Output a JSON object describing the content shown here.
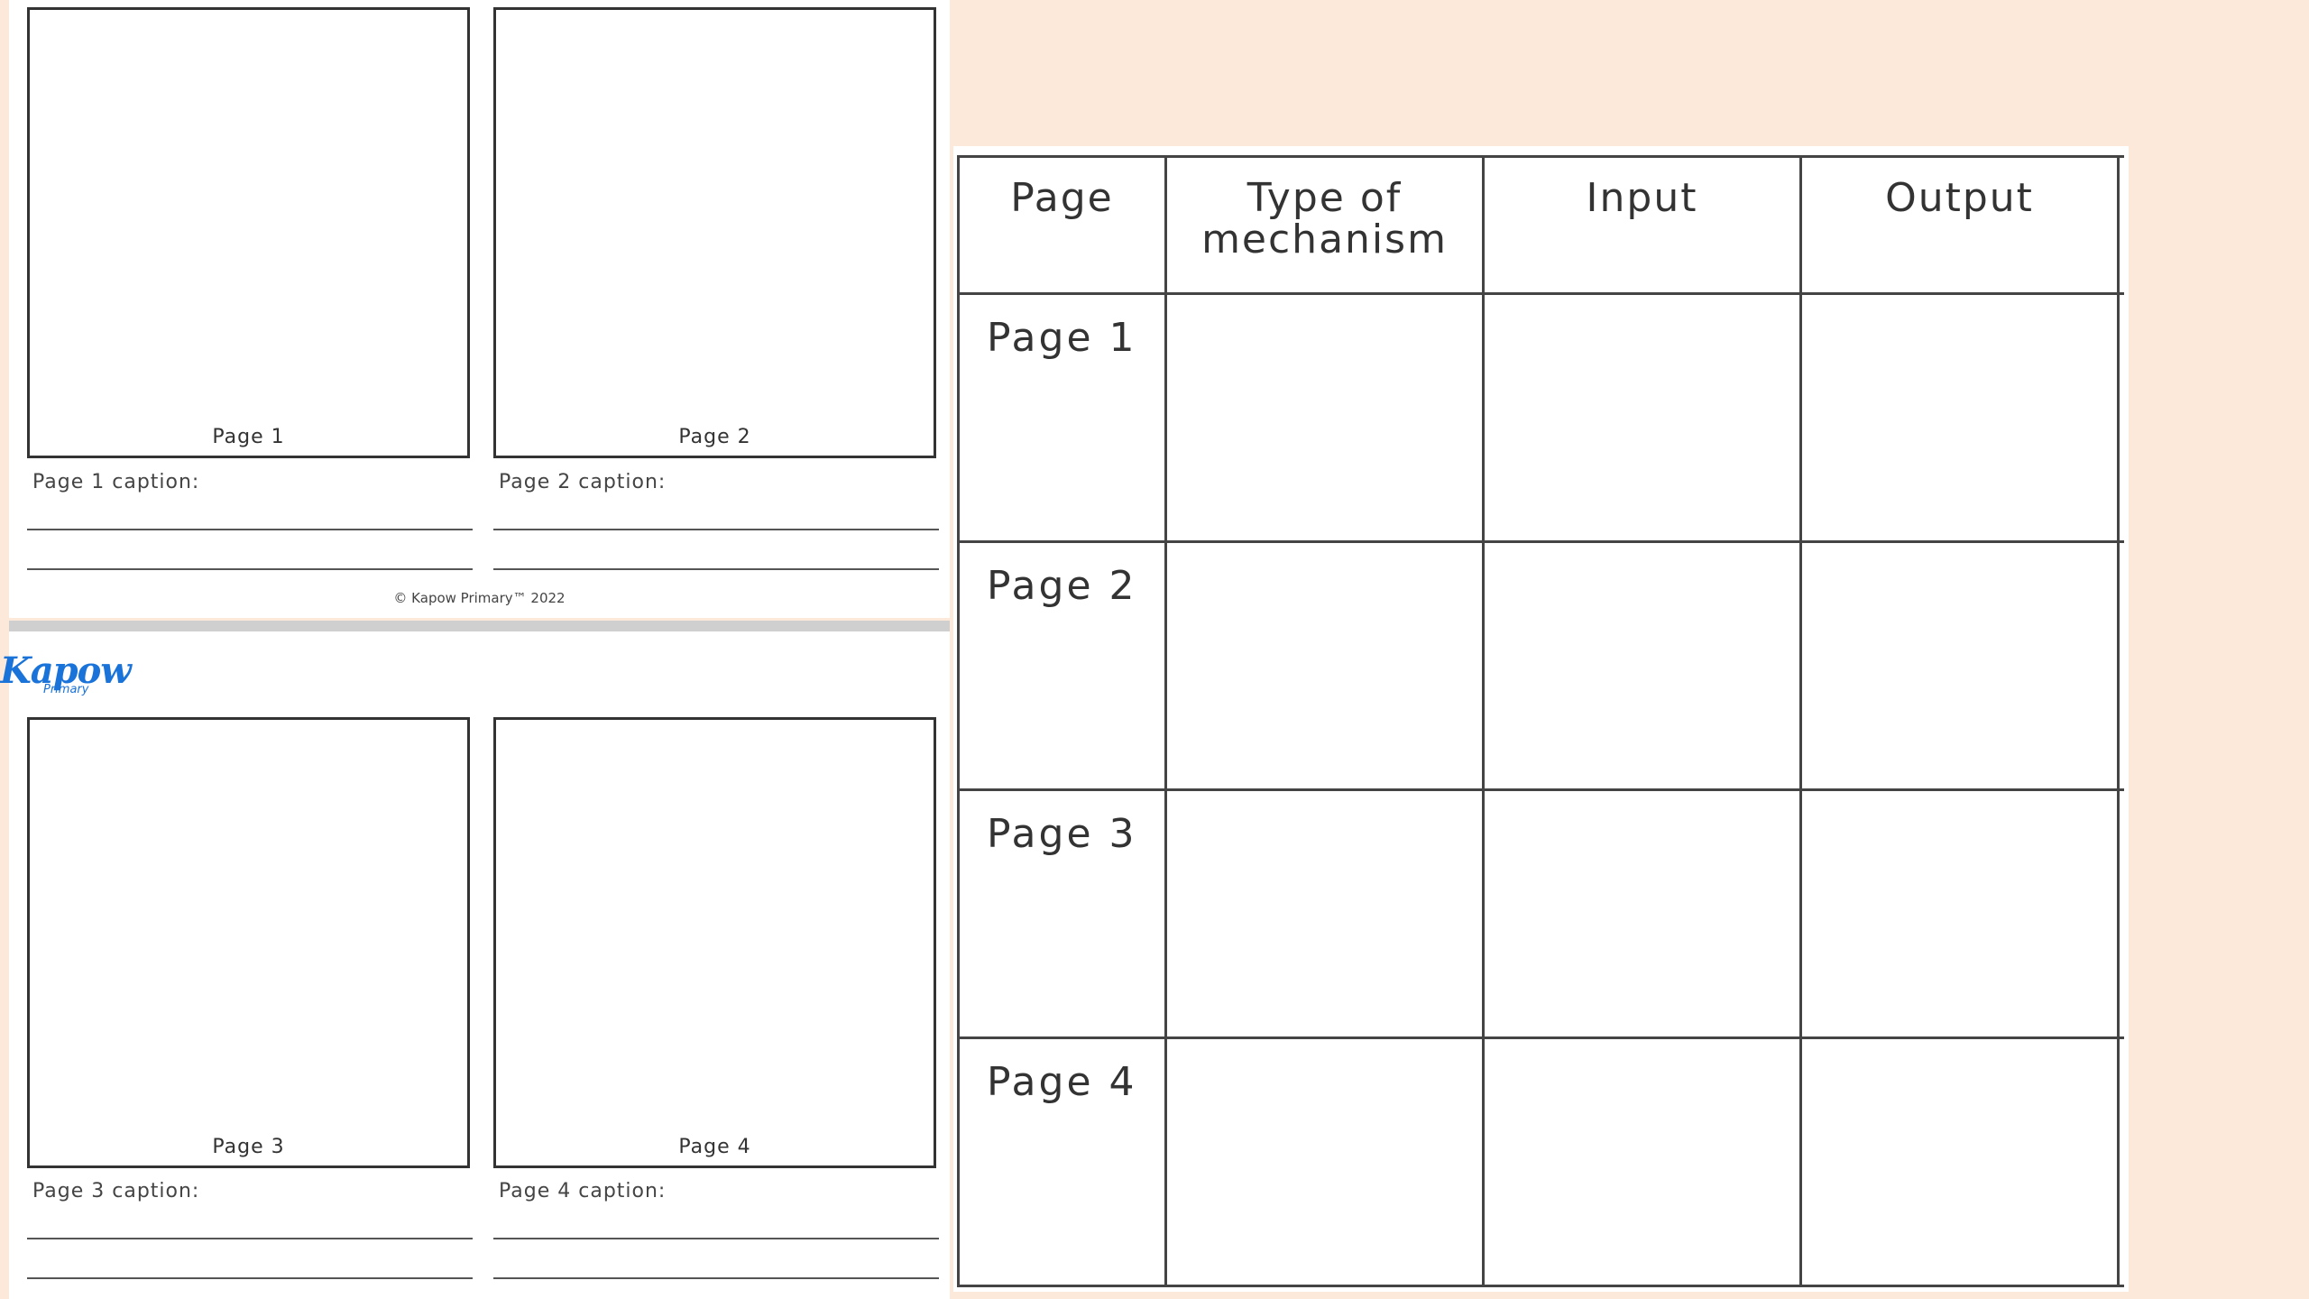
{
  "storyboard": {
    "frames": [
      {
        "label": "Page 1",
        "caption": "Page 1 caption:"
      },
      {
        "label": "Page 2",
        "caption": "Page 2 caption:"
      },
      {
        "label": "Page 3",
        "caption": "Page 3 caption:"
      },
      {
        "label": "Page 4",
        "caption": "Page 4 caption:"
      }
    ],
    "copyright": "© Kapow Primary™ 2022",
    "logo": "Kapow",
    "logo_sub": "Primary"
  },
  "table": {
    "headers": [
      "Page",
      "Type of mechanism",
      "Input",
      "Output"
    ],
    "rows": [
      "Page 1",
      "Page 2",
      "Page 3",
      "Page 4"
    ]
  }
}
